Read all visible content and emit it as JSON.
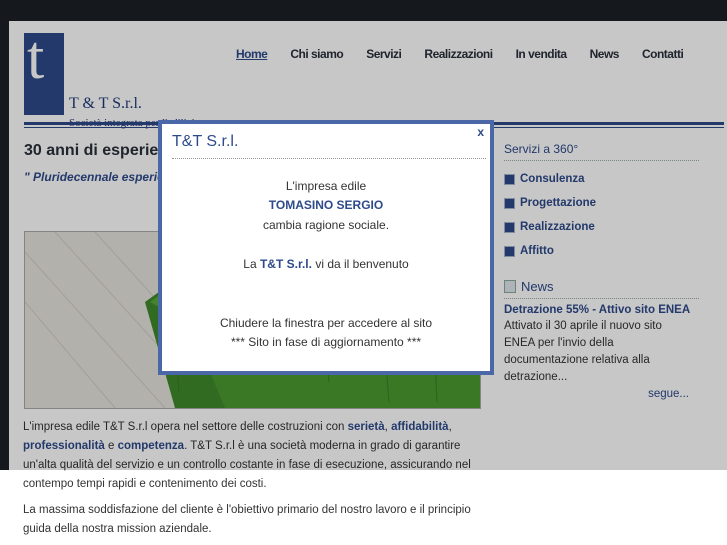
{
  "logo": {
    "mark": "t",
    "name": "T & T S.r.l.",
    "tagline": "Società integrata per l'edilizia"
  },
  "nav": {
    "items": [
      "Home",
      "Chi siamo",
      "Servizi",
      "Realizzazioni",
      "In vendita",
      "News",
      "Contatti"
    ],
    "active": "Home"
  },
  "main": {
    "title": "30 anni di esperien",
    "intro": "\" Pluridecennale esperie nuove tecnologie costru fondamenta solide nel pa"
  },
  "body": {
    "p1_parts": [
      "L'impresa edile T&T S.r.l opera nel settore delle costruzioni con ",
      "serietà",
      ", ",
      "affidabilità",
      ", ",
      "professionalità",
      " e ",
      "competenza",
      ". T&T S.r.l è una società moderna in grado di garantire un'alta qualità del servizio e un controllo costante in fase di esecuzione, assicurando nel contempo tempi rapidi e contenimento dei costi."
    ],
    "p2": "La massima soddisfazione del cliente è l'obiettivo primario del nostro lavoro e il principio guida della nostra mission aziendale."
  },
  "sidebar": {
    "services_title": "Servizi a 360°",
    "services": [
      "Consulenza",
      "Progettazione",
      "Realizzazione",
      "Affitto"
    ],
    "news_title": "News",
    "news_headline": "Detrazione 55% - Attivo sito ENEA",
    "news_text": "Attivato il 30 aprile il nuovo sito ENEA per l'invio della documentazione relativa alla detrazione...",
    "news_more": "segue..."
  },
  "modal": {
    "title": "T&T S.r.l.",
    "close": "x",
    "line1": "L'impresa edile",
    "line2": "TOMASINO SERGIO",
    "line3": "cambia ragione sociale.",
    "line4_pre": "La ",
    "line4_name": "T&T S.r.l.",
    "line4_post": " vi da il benvenuto",
    "line5": "Chiudere la finestra per accedere al sito",
    "line6": "*** Sito in fase di aggiornamento ***"
  },
  "colors": {
    "brand": "#2d4a8a",
    "modal_border": "#4a67a8",
    "dark_bg": "#1c1f26"
  }
}
